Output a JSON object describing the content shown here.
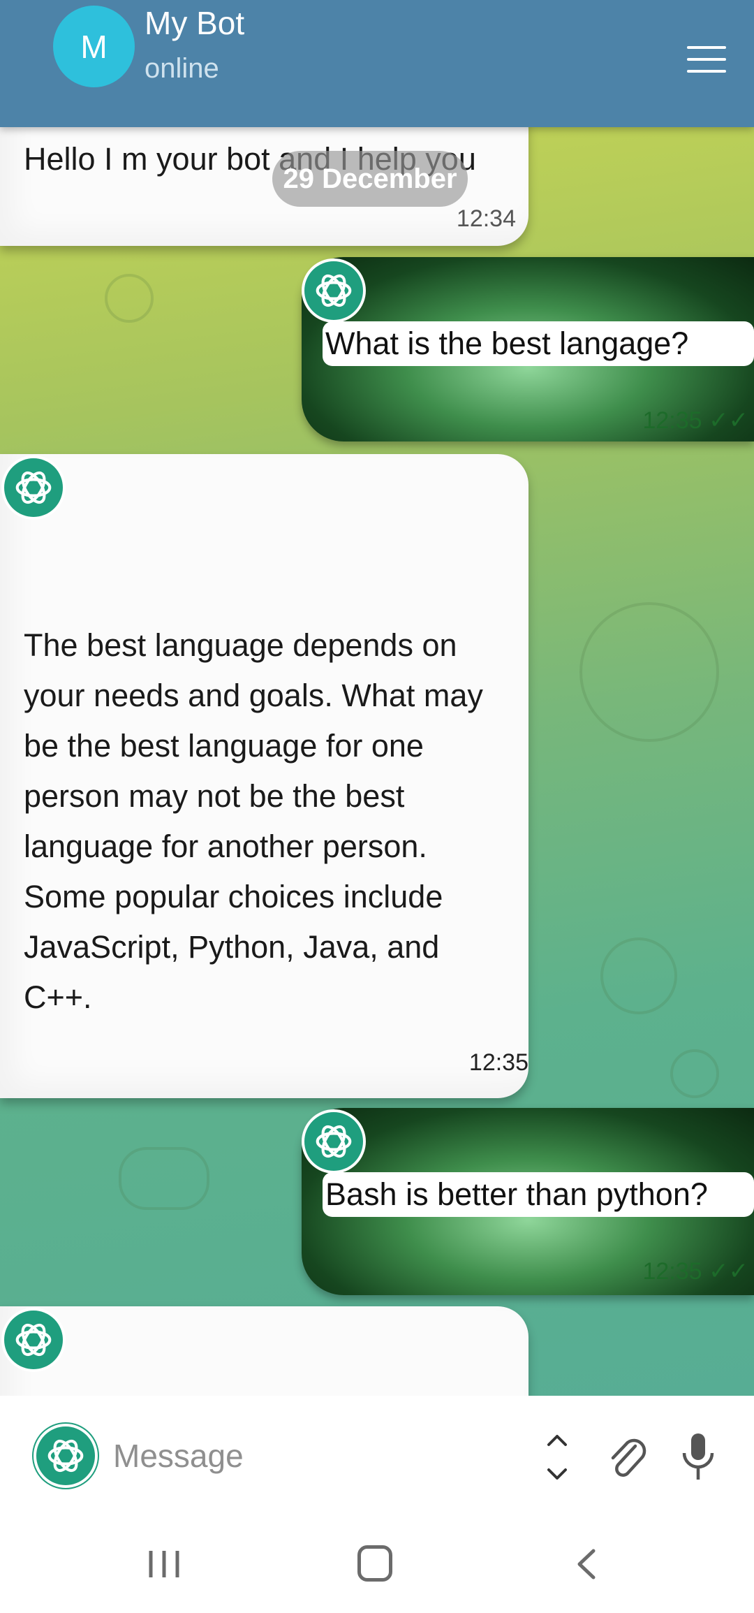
{
  "header": {
    "avatar_letter": "M",
    "title": "My Bot",
    "status": "online"
  },
  "chat": {
    "date_separator": "29 December",
    "messages": [
      {
        "direction": "incoming",
        "text": "Hello I m your bot and I help you",
        "time": "12:34"
      },
      {
        "direction": "outgoing",
        "text": "What is the best langage?",
        "time": "12:35"
      },
      {
        "direction": "incoming",
        "text": "The best language depends on your needs and goals. What may be the best language for one person may not be the best language for another person. Some popular choices include JavaScript, Python, Java, and C++.",
        "time": "12:35"
      },
      {
        "direction": "outgoing",
        "text": "Bash is better than python?",
        "time": "12:35"
      }
    ]
  },
  "input": {
    "placeholder": "Message"
  },
  "colors": {
    "header_bg": "#4d83a8",
    "avatar_bg": "#2ec0dc",
    "bot_logo": "#1f9e7e"
  },
  "icons": [
    "menu-icon",
    "chatgpt-logo-icon",
    "chevron-up-icon",
    "chevron-down-icon",
    "paperclip-icon",
    "microphone-icon",
    "recent-apps-icon",
    "home-icon",
    "back-icon"
  ]
}
